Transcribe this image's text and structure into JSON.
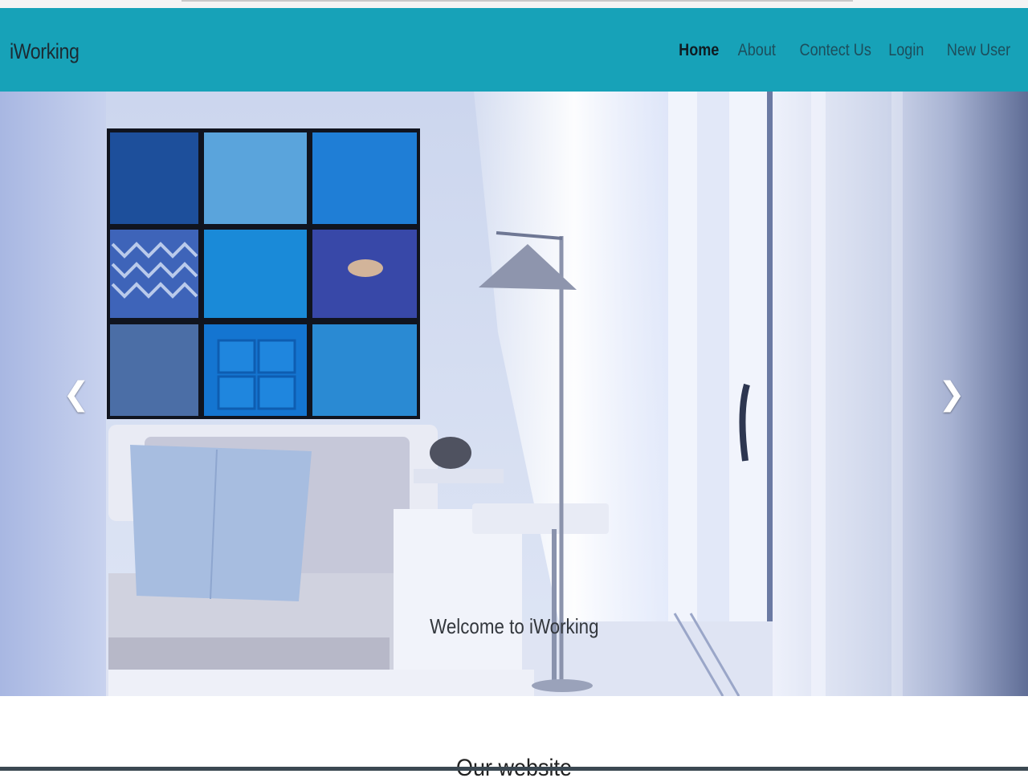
{
  "navbar": {
    "brand": "iWorking",
    "links": [
      {
        "label": "Home",
        "active": true
      },
      {
        "label": "About",
        "active": false
      },
      {
        "label": "Contect Us",
        "active": false
      },
      {
        "label": "Login",
        "active": false
      },
      {
        "label": "New User",
        "active": false
      }
    ],
    "color": "#17a2b8"
  },
  "carousel": {
    "caption": "Welcome to iWorking",
    "prev_icon": "chevron-left-icon",
    "next_icon": "chevron-right-icon",
    "prev_glyph": "❮",
    "next_glyph": "❯"
  },
  "section": {
    "title": "Our website"
  }
}
